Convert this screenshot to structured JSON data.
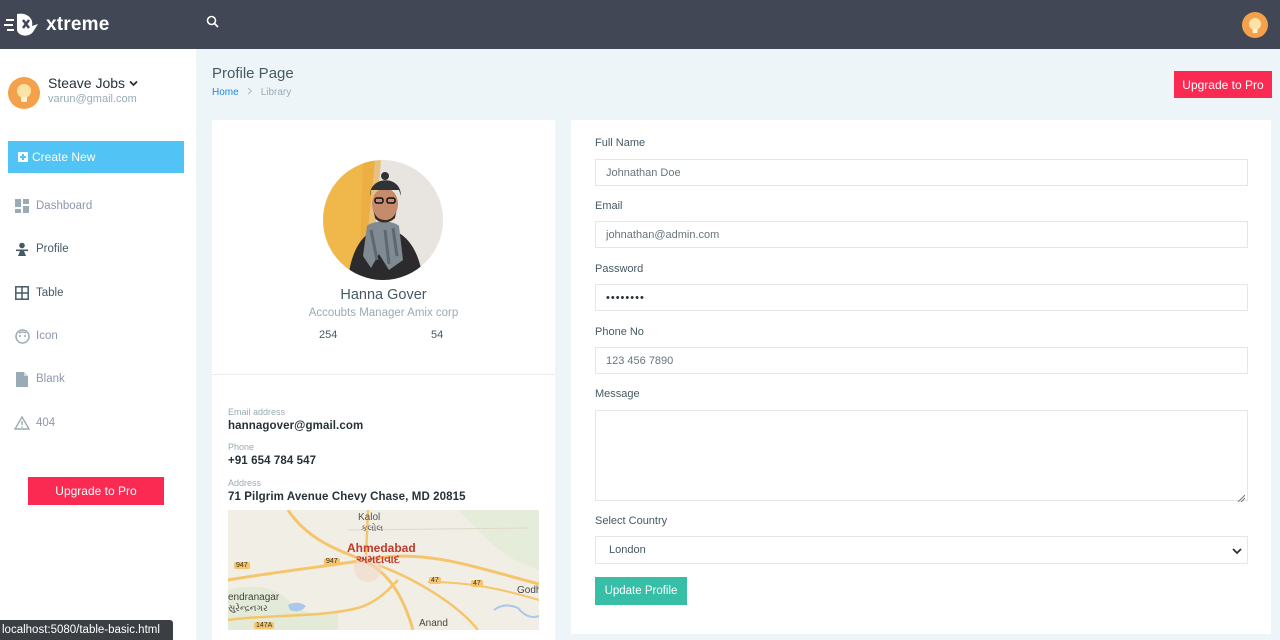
{
  "app": {
    "logo_text": "xtreme"
  },
  "user": {
    "name": "Steave Jobs",
    "email": "varun@gmail.com"
  },
  "sidebar": {
    "create_label": "Create New",
    "items": [
      {
        "label": "Dashboard",
        "icon": "dashboard-icon"
      },
      {
        "label": "Profile",
        "icon": "profile-icon"
      },
      {
        "label": "Table",
        "icon": "table-icon"
      },
      {
        "label": "Icon",
        "icon": "face-icon"
      },
      {
        "label": "Blank",
        "icon": "file-icon"
      },
      {
        "label": "404",
        "icon": "warning-icon"
      }
    ],
    "upgrade_label": "Upgrade to Pro"
  },
  "header": {
    "title": "Profile Page",
    "breadcrumb": [
      "Home",
      "Library"
    ],
    "upgrade_label": "Upgrade to Pro"
  },
  "profile": {
    "name": "Hanna Gover",
    "role": "Accoubts Manager Amix corp",
    "stats": [
      "254",
      "54"
    ],
    "email_label": "Email address",
    "email": "hannagover@gmail.com",
    "phone_label": "Phone",
    "phone": "+91 654 784 547",
    "address_label": "Address",
    "address": "71 Pilgrim Avenue Chevy Chase, MD 20815",
    "map_labels": {
      "kalol": "Kalol",
      "kalol_local": "કલોલ",
      "ahmedabad": "Ahmedabad",
      "ahmedabad_local": "અમદાવાદ",
      "surendranagar": "endranagar",
      "surendranagar_local": "સુરેન્દ્રનગર",
      "anand": "Anand",
      "godhra": "Godh",
      "road_947a": "947",
      "road_947b": "947",
      "road_47a": "47",
      "road_47b": "47",
      "road_147a": "147A"
    }
  },
  "form": {
    "full_name_label": "Full Name",
    "full_name": "Johnathan Doe",
    "email_label": "Email",
    "email": "johnathan@admin.com",
    "password_label": "Password",
    "password": "••••••••",
    "phone_label": "Phone No",
    "phone": "123 456 7890",
    "message_label": "Message",
    "message": "",
    "country_label": "Select Country",
    "country": "London",
    "submit_label": "Update Profile"
  },
  "status_bar": {
    "url": "localhost:5080/table-basic.html"
  },
  "colors": {
    "topbar": "#414755",
    "accent_blue": "#52c3f5",
    "danger": "#fb2a52",
    "success": "#36bea6"
  }
}
